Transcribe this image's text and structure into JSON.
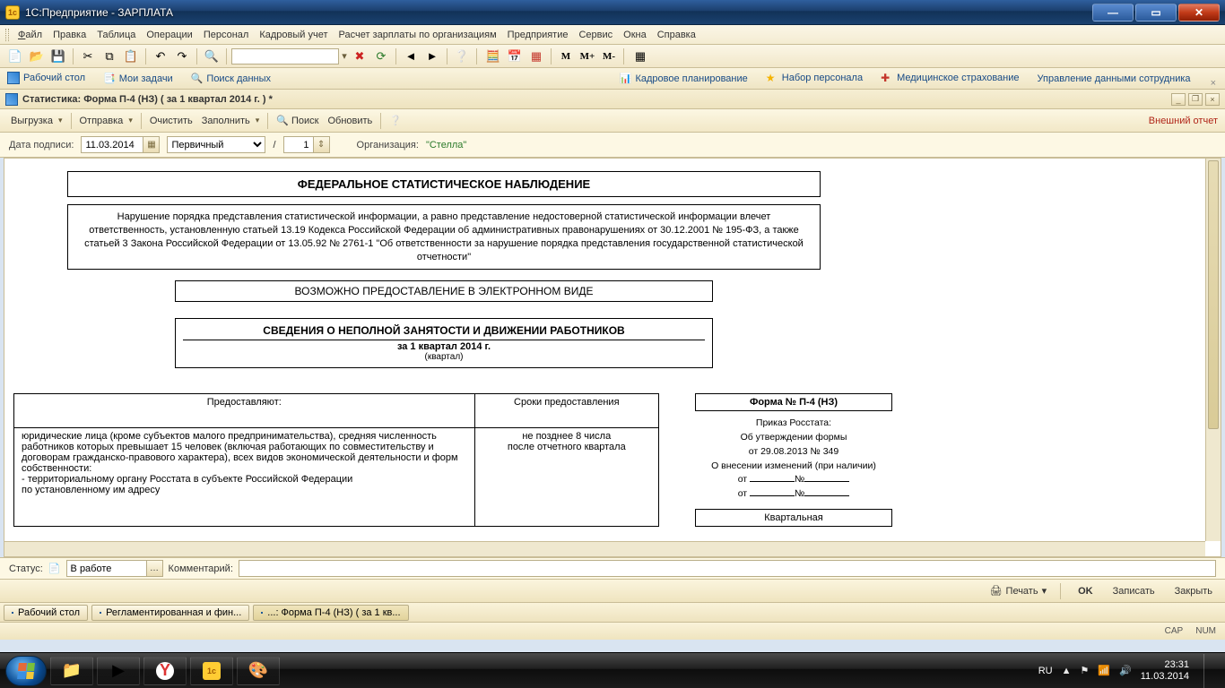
{
  "window": {
    "title": "1С:Предприятие - ЗАРПЛАТА"
  },
  "menu": [
    "Файл",
    "Правка",
    "Таблица",
    "Операции",
    "Персонал",
    "Кадровый учет",
    "Расчет зарплаты по организациям",
    "Предприятие",
    "Сервис",
    "Окна",
    "Справка"
  ],
  "tabbar": {
    "desktop": "Рабочий стол",
    "tasks": "Мои задачи",
    "searchdata": "Поиск данных",
    "planning": "Кадровое планирование",
    "recruit": "Набор персонала",
    "med": "Медицинское страхование",
    "empdata": "Управление данными сотрудника"
  },
  "toolbar2": {
    "m": "M",
    "mplus": "M+",
    "mminus": "M-"
  },
  "doc": {
    "title": "Статистика: Форма П-4 (НЗ) ( за 1 квартал 2014 г. ) *",
    "actions": {
      "export": "Выгрузка",
      "send": "Отправка",
      "clear": "Очистить",
      "fill": "Заполнить",
      "search": "Поиск",
      "refresh": "Обновить",
      "external": "Внешний отчет"
    },
    "params": {
      "sign_label": "Дата подписи:",
      "sign_date": "11.03.2014",
      "doc_type": "Первичный",
      "slash": "/",
      "num": "1",
      "org_label": "Организация:",
      "org_value": "\"Стелла\""
    }
  },
  "page": {
    "title1": "ФЕДЕРАЛЬНОЕ СТАТИСТИЧЕСКОЕ НАБЛЮДЕНИЕ",
    "notice": "Нарушение порядка представления статистической информации, а равно представление недостоверной статистической информации влечет ответственность, установленную статьей 13.19 Кодекса Российской Федерации об административных правонарушениях от 30.12.2001 № 195-ФЗ, а также статьей 3 Закона Российской Федерации от 13.05.92 № 2761-1 \"Об ответственности за нарушение порядка представления государственной статистической отчетности\"",
    "electronic": "ВОЗМОЖНО ПРЕДОСТАВЛЕНИЕ В ЭЛЕКТРОННОМ ВИДЕ",
    "info_head": "СВЕДЕНИЯ О НЕПОЛНОЙ ЗАНЯТОСТИ И ДВИЖЕНИИ РАБОТНИКОВ",
    "info_period": "за 1 квартал 2014 г.",
    "info_sub": "(квартал)",
    "t_provide": "Предоставляют:",
    "t_terms": "Сроки предоставления",
    "t_provide_body": "юридические лица (кроме субъектов малого предпринимательства), средняя численность работников которых превышает 15 человек (включая работающих по совместительству и договорам гражданско-правового характера), всех видов экономической деятельности и форм собственности:\n   - территориальному органу Росстата в субъекте Российской Федерации\n     по установленному им адресу",
    "t_terms_body": "не позднее 8 числа\nпосле отчетного квартала",
    "form_no": "Форма № П-4 (НЗ)",
    "order1": "Приказ Росстата:",
    "order2": "Об утверждении формы",
    "order3": "от 29.08.2013 № 349",
    "order4": "О внесении изменений (при наличии)",
    "from": "от",
    "no": "№",
    "periodicity": "Квартальная"
  },
  "status": {
    "label": "Статус:",
    "value": "В работе",
    "comment_label": "Комментарий:"
  },
  "footer": {
    "print": "Печать",
    "ok": "OK",
    "save": "Записать",
    "close": "Закрыть"
  },
  "apptabs": {
    "desktop": "Рабочий стол",
    "reg": "Регламентированная и фин...",
    "form": "...: Форма П-4 (НЗ) ( за 1 кв..."
  },
  "statusline": {
    "cap": "CAP",
    "num": "NUM"
  },
  "tray": {
    "lang": "RU",
    "time": "23:31",
    "date": "11.03.2014"
  }
}
